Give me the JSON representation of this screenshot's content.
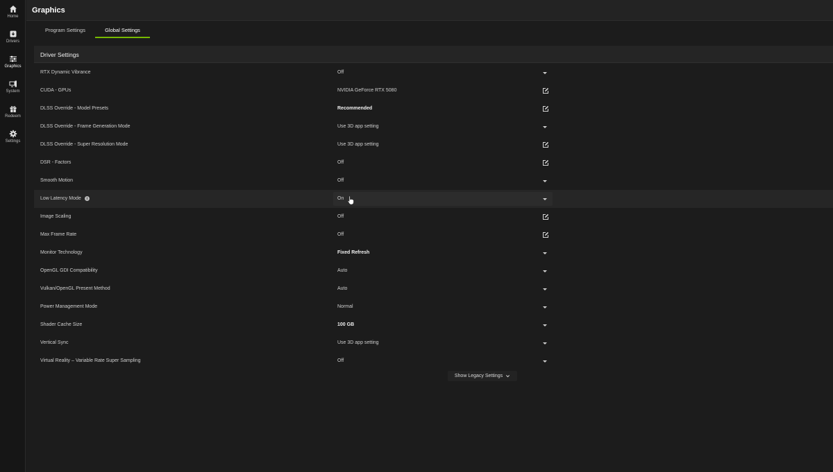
{
  "sidebar": {
    "items": [
      {
        "label": "Home",
        "icon": "home-icon"
      },
      {
        "label": "Drivers",
        "icon": "drivers-icon"
      },
      {
        "label": "Graphics",
        "icon": "sliders-icon"
      },
      {
        "label": "System",
        "icon": "system-icon"
      },
      {
        "label": "Redeem",
        "icon": "gift-icon"
      },
      {
        "label": "Settings",
        "icon": "gear-icon"
      }
    ],
    "active": "Graphics"
  },
  "header": {
    "title": "Graphics"
  },
  "tabs": [
    {
      "label": "Program Settings"
    },
    {
      "label": "Global Settings",
      "active": true
    }
  ],
  "panel": {
    "title": "Driver Settings",
    "rows": [
      {
        "name": "RTX Dynamic Vibrance",
        "value": "Off",
        "control": "dropdown"
      },
      {
        "name": "CUDA - GPUs",
        "value": "NVIDIA GeForce RTX 5080",
        "control": "edit"
      },
      {
        "name": "DLSS Override - Model Presets",
        "value": "Recommended",
        "control": "edit",
        "bold": true
      },
      {
        "name": "DLSS Override - Frame Generation Mode",
        "value": "Use 3D app setting",
        "control": "dropdown"
      },
      {
        "name": "DLSS Override - Super Resolution Mode",
        "value": "Use 3D app setting",
        "control": "edit"
      },
      {
        "name": "DSR - Factors",
        "value": "Off",
        "control": "edit"
      },
      {
        "name": "Smooth Motion",
        "value": "Off",
        "control": "dropdown"
      },
      {
        "name": "Low Latency Mode",
        "value": "On",
        "control": "dropdown",
        "info": true,
        "highlight": true
      },
      {
        "name": "Image Scaling",
        "value": "Off",
        "control": "edit"
      },
      {
        "name": "Max Frame Rate",
        "value": "Off",
        "control": "edit"
      },
      {
        "name": "Monitor Technology",
        "value": "Fixed Refresh",
        "control": "dropdown",
        "bold": true
      },
      {
        "name": "OpenGL GDI Compatibility",
        "value": "Auto",
        "control": "dropdown"
      },
      {
        "name": "Vulkan/OpenGL Present Method",
        "value": "Auto",
        "control": "dropdown"
      },
      {
        "name": "Power Management Mode",
        "value": "Normal",
        "control": "dropdown"
      },
      {
        "name": "Shader Cache Size",
        "value": "100 GB",
        "control": "dropdown",
        "bold": true
      },
      {
        "name": "Vertical Sync",
        "value": "Use 3D app setting",
        "control": "dropdown"
      },
      {
        "name": "Virtual Reality – Variable Rate Super Sampling",
        "value": "Off",
        "control": "dropdown"
      }
    ]
  },
  "legacy_button": {
    "label": "Show Legacy Settings",
    "icon": "chevron-down-icon"
  },
  "colors": {
    "accent": "#76b900",
    "background": "#1c1c1c",
    "sidebar": "#161616"
  }
}
